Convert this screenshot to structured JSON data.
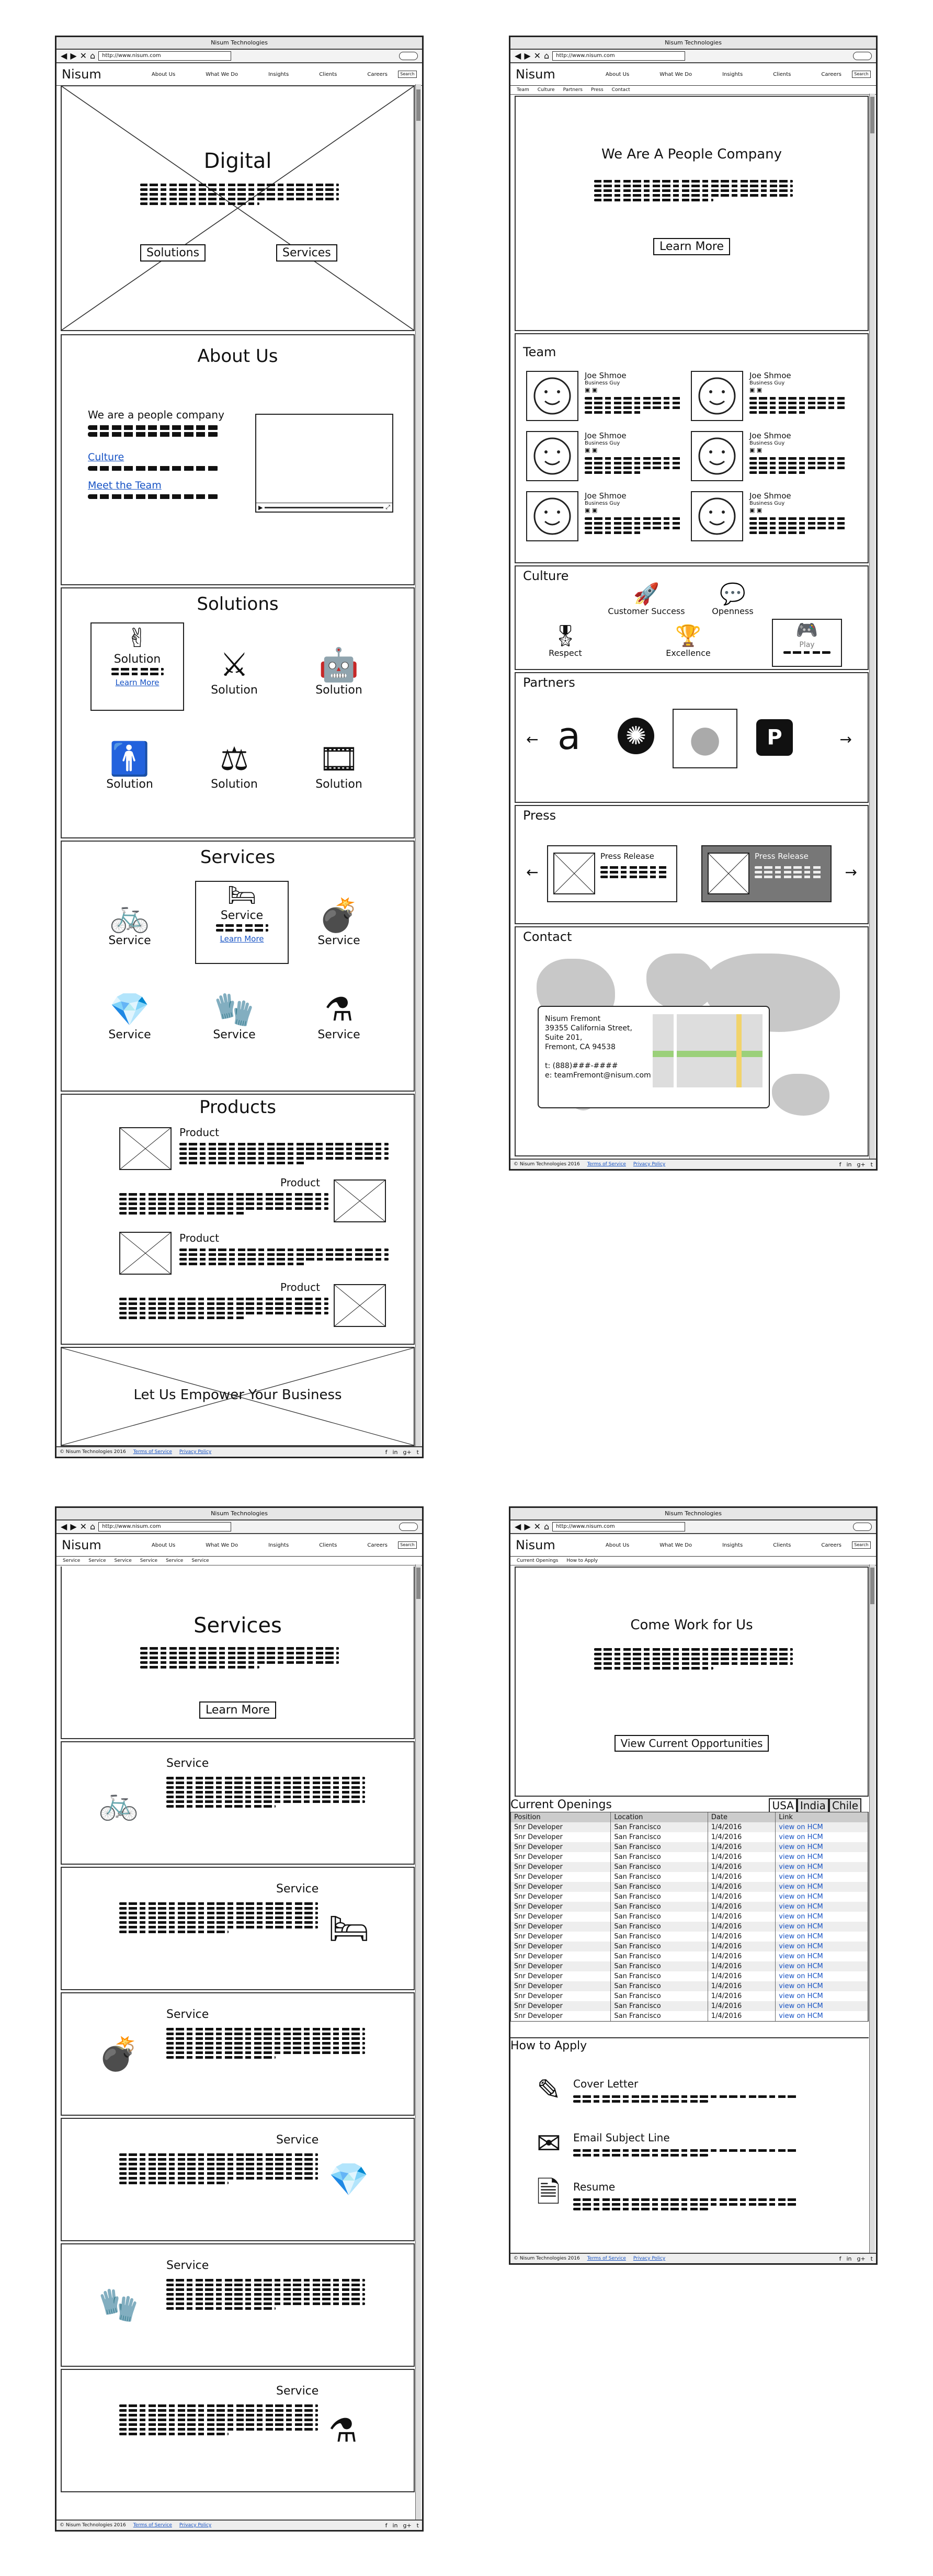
{
  "browser": {
    "title": "Nisum Technologies",
    "url": "http://www.nisum.com",
    "back_glyph": "◀",
    "forward_glyph": "▶",
    "close_glyph": "✕",
    "home_glyph": "⌂"
  },
  "header": {
    "logo": "Nisum",
    "menu": [
      "About Us",
      "What We Do",
      "Insights",
      "Clients",
      "Careers"
    ],
    "search_label": "Search"
  },
  "footer": {
    "copyright": "© Nisum Technologies 2016",
    "terms": "Terms of Service",
    "privacy": "Privacy Policy",
    "icons": [
      "facebook-icon",
      "linkedin-icon",
      "google-plus-icon",
      "twitter-icon"
    ]
  },
  "home": {
    "hero_title": "Digital",
    "hero_btn_solutions": "Solutions",
    "hero_btn_services": "Services",
    "about_title": "About Us",
    "about_lead": "We are a people company",
    "about_link_culture": "Culture",
    "about_link_team": "Meet the Team",
    "solutions_title": "Solutions",
    "solution_label": "Solution",
    "learn_more_link": "Learn More",
    "services_title": "Services",
    "service_label": "Service",
    "products_title": "Products",
    "product_label": "Product",
    "cta": "Let Us Empower Your Business"
  },
  "about": {
    "subnav": [
      "Team",
      "Culture",
      "Partners",
      "Press",
      "Contact"
    ],
    "hero_title": "We Are A People Company",
    "hero_btn": "Learn More",
    "team_title": "Team",
    "member_name": "Joe Shmoe",
    "member_role": "Business Guy",
    "culture_title": "Culture",
    "culture_items": [
      "Customer Success",
      "Openness",
      "Respect",
      "Excellence",
      "Play"
    ],
    "partners_title": "Partners",
    "press_title": "Press",
    "press_item": "Press Release",
    "contact_title": "Contact",
    "contact_address": [
      "Nisum Fremont",
      "39355 California Street,",
      "Suite 201,",
      "Fremont, CA 94538"
    ],
    "contact_phone": "t: (888)###-####",
    "contact_email": "e: teamFremont@nisum.com"
  },
  "services_page": {
    "subnav": [
      "Service",
      "Service",
      "Service",
      "Service",
      "Service",
      "Service"
    ],
    "hero_title": "Services",
    "hero_btn": "Learn More",
    "item_label": "Service"
  },
  "careers": {
    "subnav": [
      "Current Openings",
      "How to Apply"
    ],
    "hero_title": "Come Work for Us",
    "hero_btn": "View Current Opportunities",
    "openings_title": "Current Openings",
    "tabs": [
      "USA",
      "India",
      "Chile"
    ],
    "columns": [
      "Position",
      "Location",
      "Date",
      "Link"
    ],
    "row": {
      "position": "Snr Developer",
      "location": "San Francisco",
      "date": "1/4/2016",
      "link": "view on HCM"
    },
    "row_count": 20,
    "apply_title": "How to Apply",
    "apply_steps": [
      "Cover Letter",
      "Email Subject Line",
      "Resume"
    ]
  }
}
